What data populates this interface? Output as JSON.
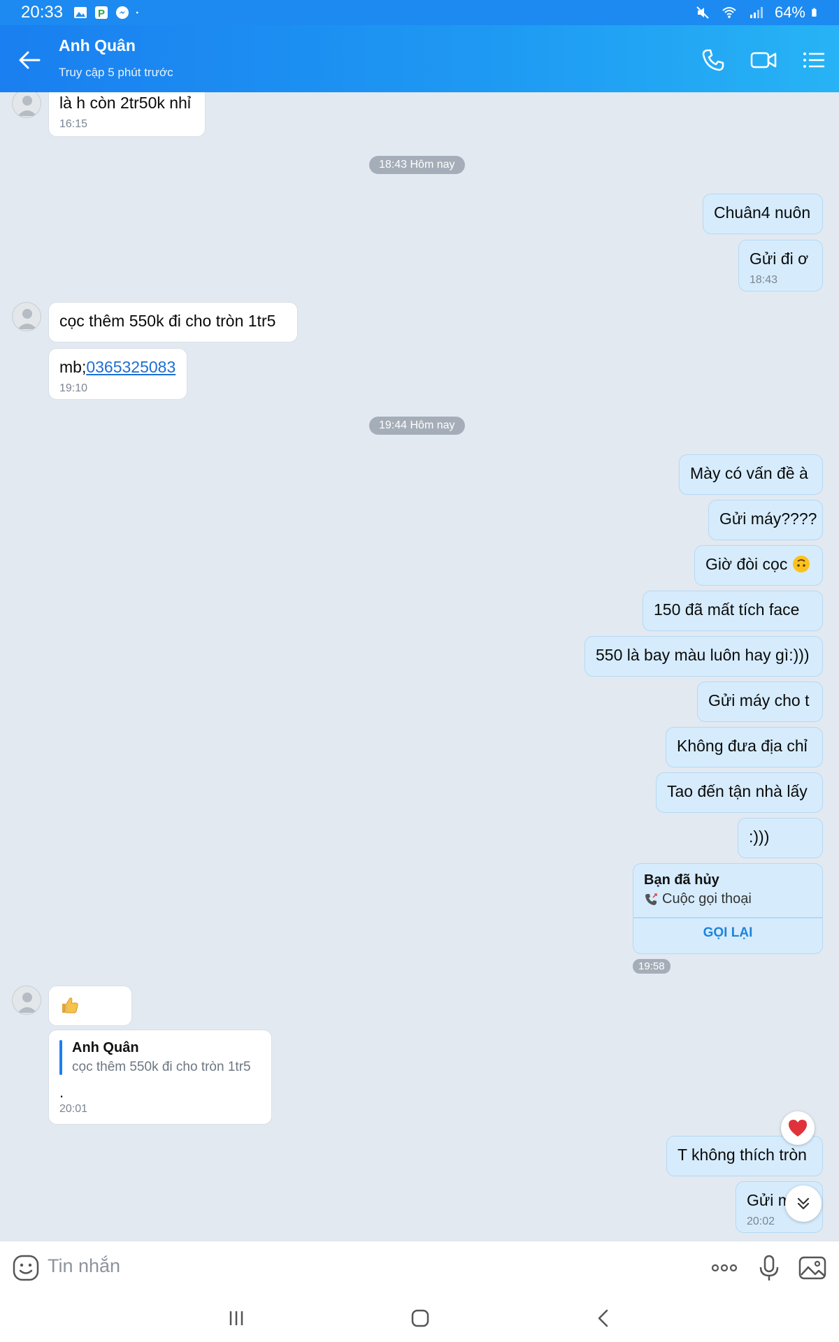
{
  "status_bar": {
    "time": "20:33",
    "battery": "64%",
    "left_icons": [
      "gallery-icon",
      "app-icon",
      "messenger-icon"
    ],
    "right_icons": [
      "mute-icon",
      "wifi-icon",
      "signal-icon",
      "battery-icon"
    ]
  },
  "header": {
    "name": "Anh Quân",
    "status": "Truy cập 5 phút trước",
    "icons": [
      "back-arrow-icon",
      "phone-icon",
      "video-icon",
      "menu-list-icon"
    ]
  },
  "messages": {
    "m1": {
      "text": "là h còn 2tr50k nhỉ",
      "time": "16:15"
    },
    "divider1": "18:43 Hôm nay",
    "m2": {
      "text": "Chuân4 nuôn"
    },
    "m3": {
      "text": "Gửi đi ơ",
      "time": "18:43"
    },
    "m4": {
      "text": "cọc thêm 550k đi cho tròn 1tr5"
    },
    "m5": {
      "prefix": "mb;",
      "phone": "0365325083",
      "time": "19:10"
    },
    "divider2": "19:44 Hôm nay",
    "m6": {
      "text": "Mày có vấn đề à"
    },
    "m7": {
      "text": "Gửi máy????"
    },
    "m8": {
      "text": "Giờ đòi cọc"
    },
    "m9": {
      "text": "150 đã mất tích face"
    },
    "m10": {
      "text": "550 là bay màu luôn hay gì:)))"
    },
    "m11": {
      "text": "Gửi máy cho t"
    },
    "m12": {
      "text": "Không đưa địa chỉ"
    },
    "m13": {
      "text": "Tao đến tận nhà lấy"
    },
    "m14": {
      "text": ":)))"
    },
    "call": {
      "title": "Bạn đã hủy",
      "subtitle": "Cuộc gọi thoại",
      "action": "GỌI LẠI",
      "time": "19:58"
    },
    "m15": {
      "icon": "thumbs-up-icon"
    },
    "reply": {
      "quoted_name": "Anh Quân",
      "quoted_text": "cọc thêm 550k đi cho tròn 1tr5",
      "body": ".",
      "time": "20:01"
    },
    "m16": {
      "text": "T không thích tròn",
      "reaction": "heart-icon"
    },
    "m17": {
      "text": "Gửi m",
      "time": "20:02"
    }
  },
  "input": {
    "placeholder": "Tin nhắn",
    "icons": [
      "sticker-icon",
      "more-icon",
      "mic-icon",
      "image-icon"
    ]
  },
  "navbar": {
    "icons": [
      "recent-apps-icon",
      "home-icon",
      "back-icon"
    ]
  },
  "colors": {
    "header": "#1c8af0",
    "outgoing_bubble": "#d6ecfd",
    "incoming_bubble": "#ffffff",
    "chat_background": "#e2e9f1",
    "link": "#1d6fd1",
    "callback": "#1e84db"
  }
}
